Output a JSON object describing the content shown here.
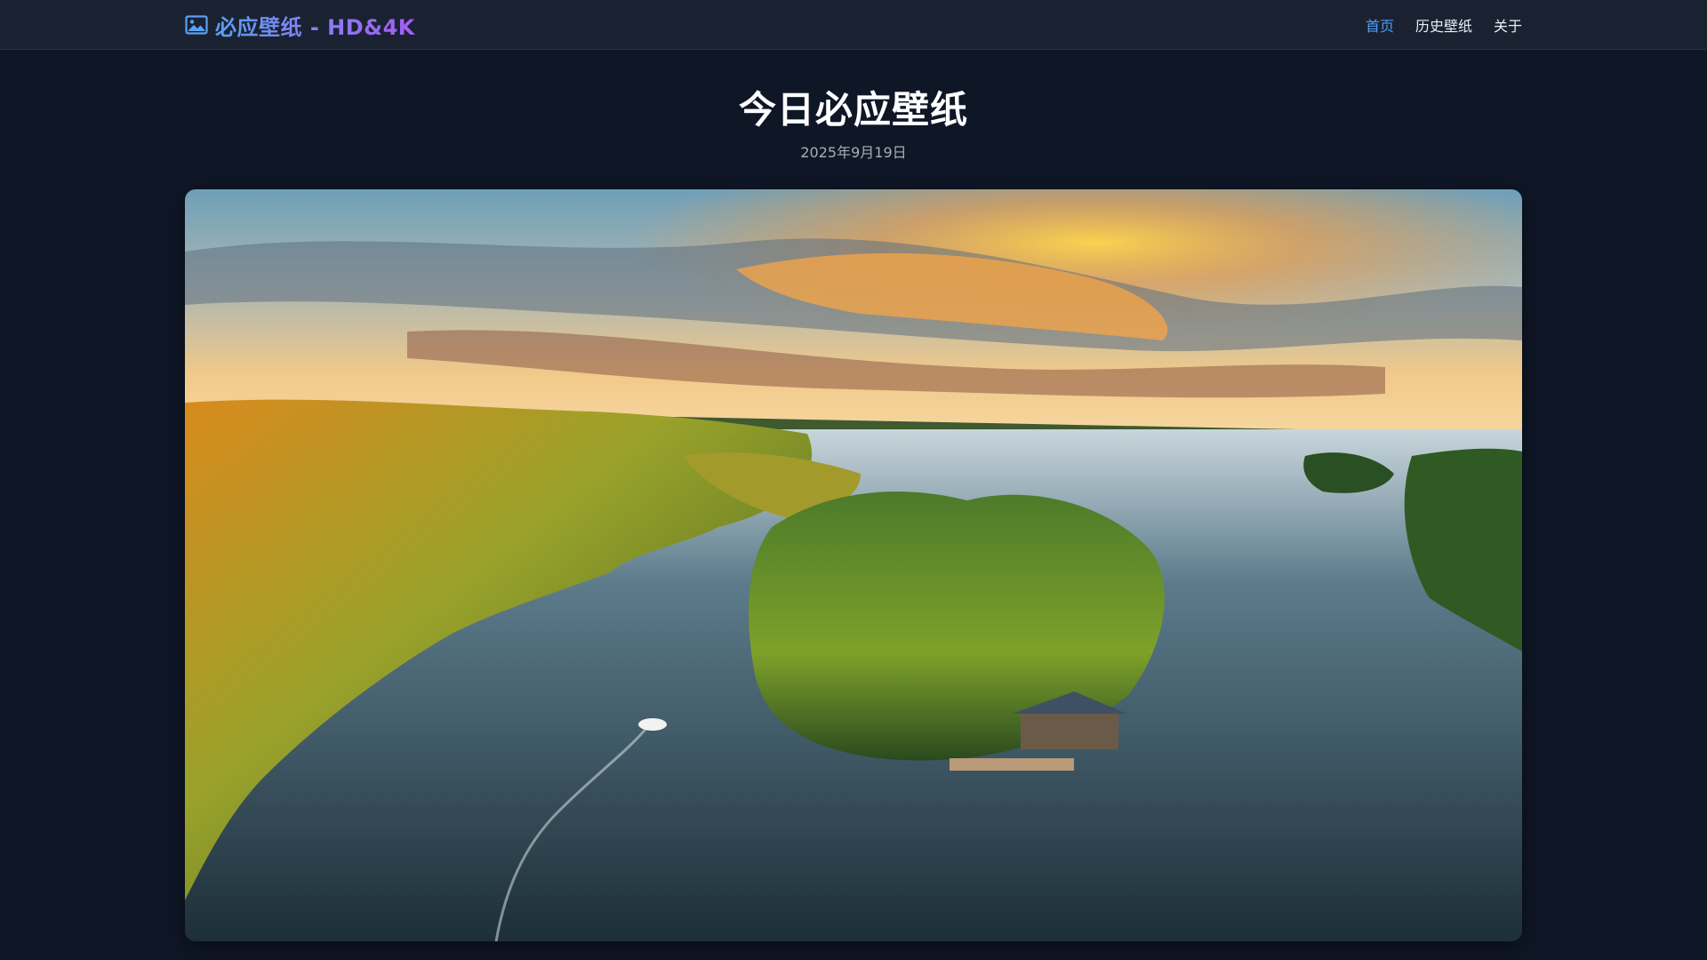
{
  "brand": {
    "title": "必应壁纸 - HD&4K",
    "icon": "image-icon"
  },
  "nav": {
    "items": [
      {
        "label": "首页",
        "active": true
      },
      {
        "label": "历史壁纸",
        "active": false
      },
      {
        "label": "关于",
        "active": false
      }
    ]
  },
  "main": {
    "heading": "今日必应壁纸",
    "date": "2025年9月19日"
  },
  "colors": {
    "background": "#0f1626",
    "topbar": "#1a2232",
    "accent": "#4a9ef5",
    "brand_gradient_start": "#5aa0f2",
    "brand_gradient_end": "#a35df0"
  }
}
